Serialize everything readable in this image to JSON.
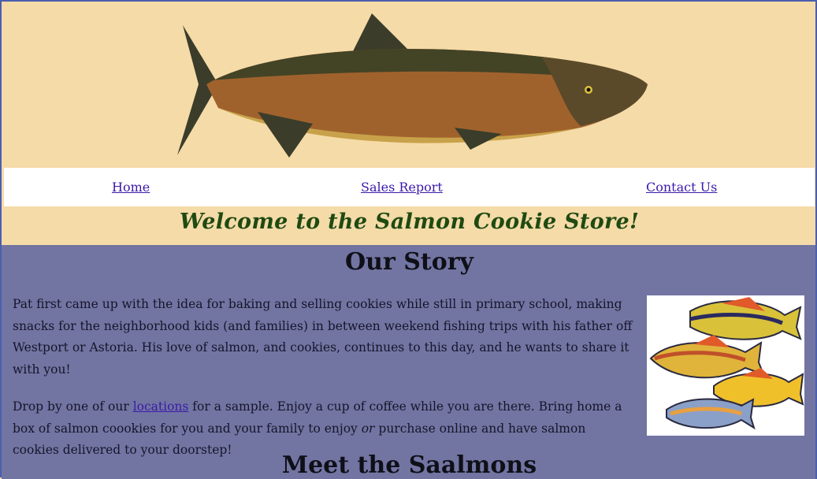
{
  "nav": {
    "home": "Home",
    "sales_report": "Sales Report",
    "contact_us": "Contact Us"
  },
  "welcome": "Welcome to the Salmon Cookie Store!",
  "story": {
    "heading": "Our Story",
    "p1": "Pat first came up with the idea for baking and selling cookies while still in primary school, making snacks for the neighborhood kids (and families) in between weekend fishing trips with his father off Westport or Astoria. His love of salmon, and cookies, continues to this day, and he wants to share it with you!",
    "p2_before_link": "Drop by one of our ",
    "p2_link": "locations",
    "p2_middle": " for a sample. Enjoy a cup of coffee while you are there. Bring home a box of salmon coookies for you and your family to enjoy ",
    "p2_or": "or",
    "p2_after": " purchase online and have salmon cookies delivered to your doorstep!"
  },
  "meet_heading": "Meet the Saalmons",
  "colors": {
    "header_bg": "#f5dba8",
    "main_bg": "#7275a2",
    "link": "#3a1aa8",
    "welcome_text": "#1f4a12"
  }
}
